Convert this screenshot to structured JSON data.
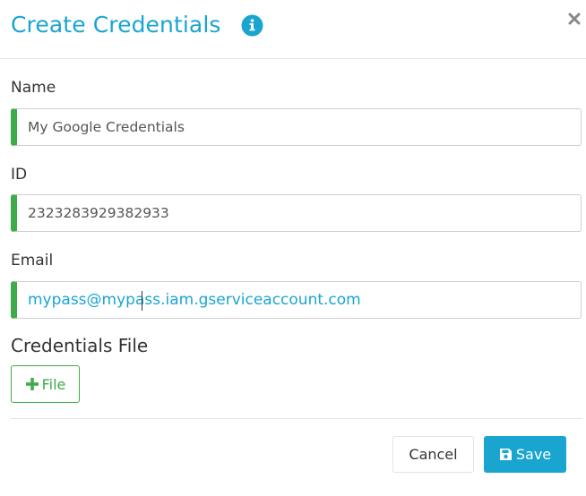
{
  "dialog": {
    "title": "Create Credentials",
    "info_icon": "info-circle-icon",
    "close_icon": "close-icon"
  },
  "form": {
    "name": {
      "label": "Name",
      "value": "My Google Credentials"
    },
    "id": {
      "label": "ID",
      "value": "2323283929382933"
    },
    "email": {
      "label": "Email",
      "value": "mypass@mypass.iam.gserviceaccount.com",
      "focused": true
    },
    "credentials_file": {
      "label": "Credentials File",
      "button_label": "File",
      "button_icon": "plus-icon"
    }
  },
  "footer": {
    "cancel_label": "Cancel",
    "save_label": "Save",
    "save_icon": "floppy-disk-icon"
  },
  "colors": {
    "accent": "#1aa5d1",
    "field_indicator": "#3cab4a",
    "file_button": "#3cab4a"
  }
}
